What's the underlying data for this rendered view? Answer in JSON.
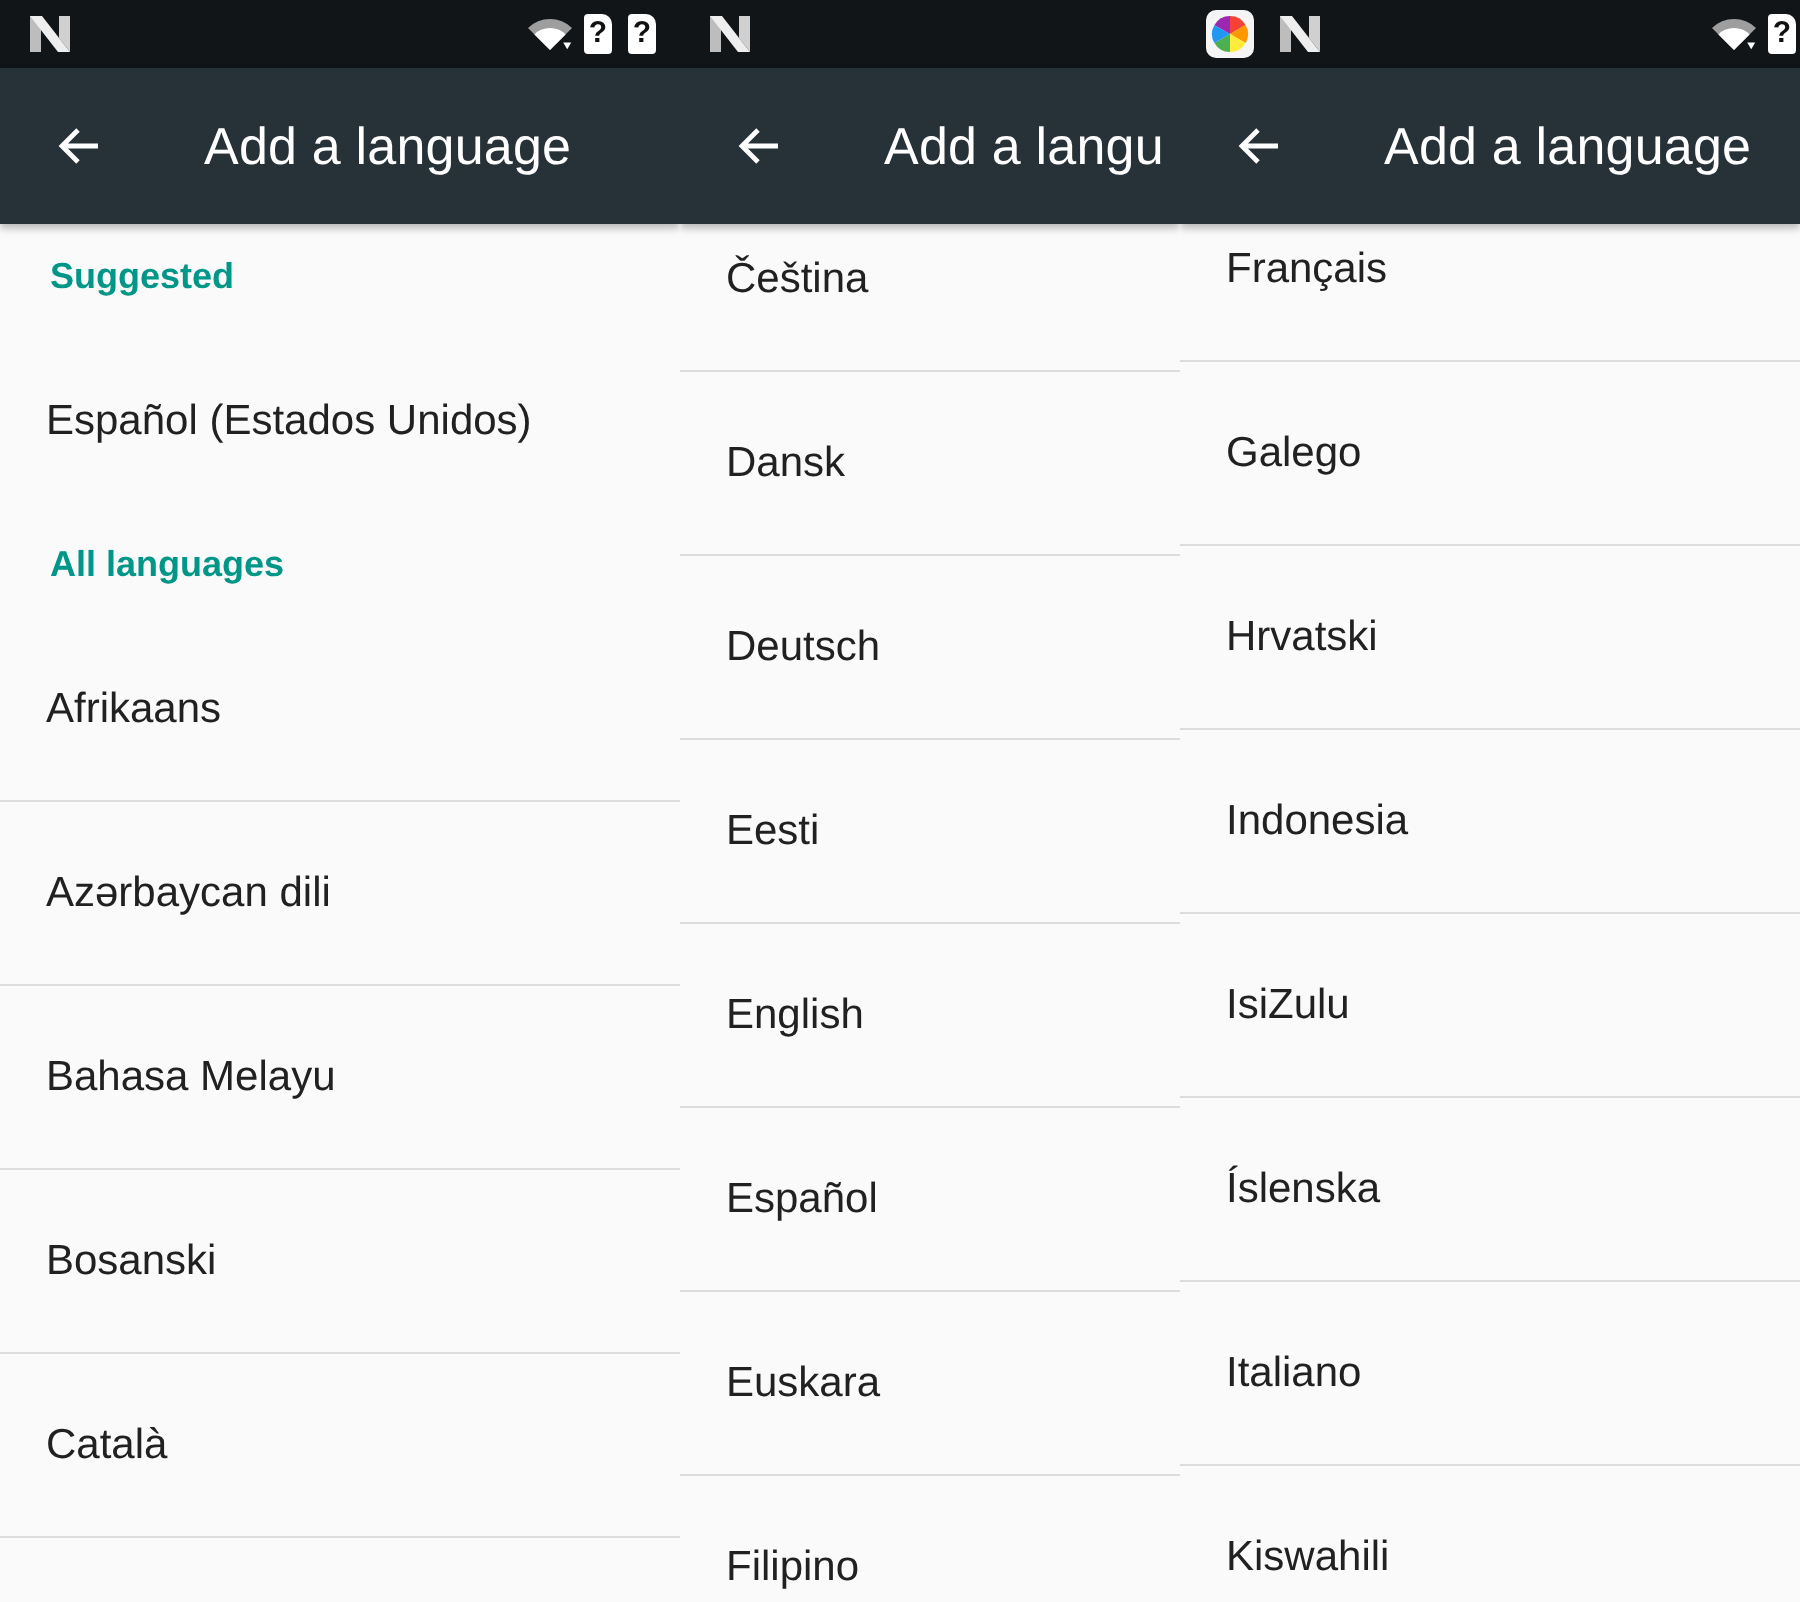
{
  "screens": [
    {
      "status_bar": {
        "left_icons": [
          {
            "kind": "n-logo"
          }
        ],
        "right_icons": [
          {
            "kind": "wifi"
          },
          {
            "kind": "sim",
            "glyph": "?"
          },
          {
            "kind": "sim",
            "glyph": "?"
          }
        ]
      },
      "app_bar": {
        "title": "Add a language"
      },
      "list": [
        {
          "kind": "header",
          "label": "Suggested"
        },
        {
          "kind": "language",
          "label": "Español (Estados Unidos)"
        },
        {
          "kind": "header",
          "label": "All languages"
        },
        {
          "kind": "language",
          "label": "Afrikaans"
        },
        {
          "kind": "language",
          "label": "Azərbaycan dili"
        },
        {
          "kind": "language",
          "label": "Bahasa Melayu"
        },
        {
          "kind": "language",
          "label": "Bosanski"
        },
        {
          "kind": "language",
          "label": "Català"
        }
      ]
    },
    {
      "status_bar": {
        "left_icons": [
          {
            "kind": "n-logo"
          }
        ]
      },
      "app_bar": {
        "title": "Add a langu"
      },
      "list": [
        {
          "kind": "language",
          "label": "Čeština"
        },
        {
          "kind": "language",
          "label": "Dansk"
        },
        {
          "kind": "language",
          "label": "Deutsch"
        },
        {
          "kind": "language",
          "label": "Eesti"
        },
        {
          "kind": "language",
          "label": "English"
        },
        {
          "kind": "language",
          "label": "Español"
        },
        {
          "kind": "language",
          "label": "Euskara"
        },
        {
          "kind": "language",
          "label": "Filipino"
        }
      ]
    },
    {
      "status_bar": {
        "left_icons": [
          {
            "kind": "color-wheel"
          },
          {
            "kind": "n-logo"
          }
        ],
        "right_icons": [
          {
            "kind": "wifi"
          },
          {
            "kind": "sim",
            "glyph": "?"
          }
        ]
      },
      "app_bar": {
        "title": "Add a language"
      },
      "list": [
        {
          "kind": "language",
          "label": "Français"
        },
        {
          "kind": "language",
          "label": "Galego"
        },
        {
          "kind": "language",
          "label": "Hrvatski"
        },
        {
          "kind": "language",
          "label": "Indonesia"
        },
        {
          "kind": "language",
          "label": "IsiZulu"
        },
        {
          "kind": "language",
          "label": "Íslenska"
        },
        {
          "kind": "language",
          "label": "Italiano"
        },
        {
          "kind": "language",
          "label": "Kiswahili"
        }
      ]
    }
  ]
}
